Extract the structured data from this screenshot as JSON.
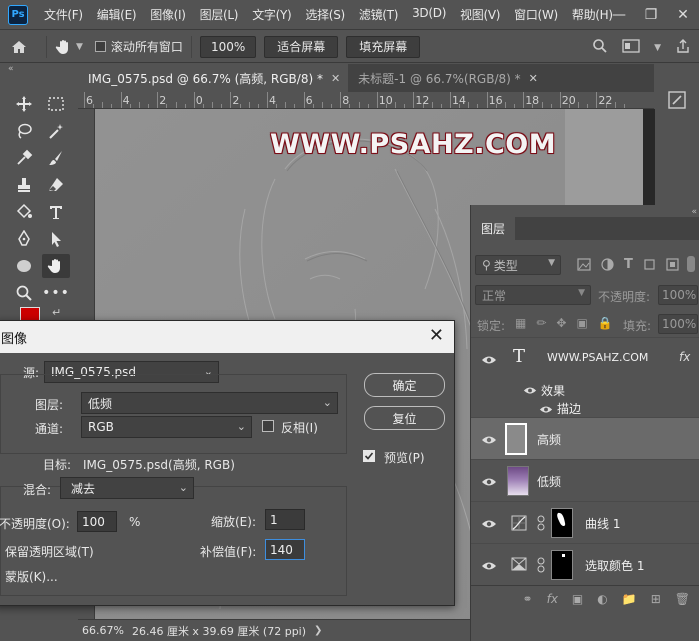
{
  "app": {
    "logo": "Ps"
  },
  "menu": [
    "文件(F)",
    "编辑(E)",
    "图像(I)",
    "图层(L)",
    "文字(Y)",
    "选择(S)",
    "滤镜(T)",
    "3D(D)",
    "视图(V)",
    "窗口(W)",
    "帮助(H)"
  ],
  "options_bar": {
    "scroll_all_label": "滚动所有窗口",
    "zoom_value": "100%",
    "fit_screen_label": "适合屏幕",
    "fill_screen_label": "填充屏幕"
  },
  "tabs": [
    {
      "label": "IMG_0575.psd @ 66.7% (高频, RGB/8) *",
      "active": true
    },
    {
      "label": "未标题-1 @ 66.7%(RGB/8) *",
      "active": false
    }
  ],
  "ruler_ticks": [
    "6",
    "4",
    "2",
    "0",
    "2",
    "4",
    "6",
    "8",
    "10",
    "12",
    "14",
    "16",
    "18",
    "20",
    "22"
  ],
  "canvas": {
    "watermark": "WWW.PSAHZ.COM"
  },
  "status": {
    "zoom": "66.67%",
    "doc_info": "26.46 厘米 x 39.69 厘米 (72 ppi)"
  },
  "layers_panel": {
    "title": "图层",
    "filter_placeholder": "类型",
    "blend_mode": "正常",
    "opacity_label": "不透明度:",
    "opacity_value": "100%",
    "lock_label": "锁定:",
    "fill_label": "填充:",
    "fill_value": "100%",
    "layers": [
      {
        "name": "WWW.PSAHZ.COM",
        "kind": "text",
        "fx": "fx",
        "effects_label": "效果",
        "effect_items": [
          "描边"
        ]
      },
      {
        "name": "高频",
        "kind": "pixel",
        "selected": true
      },
      {
        "name": "低频",
        "kind": "photo"
      },
      {
        "name": "曲线 1",
        "kind": "curves"
      },
      {
        "name": "选取颜色 1",
        "kind": "selective-color"
      }
    ]
  },
  "dialog": {
    "title": "图像",
    "source_label": "源:",
    "source_value": "IMG_0575.psd",
    "layer_label": "图层:",
    "layer_value": "低频",
    "channel_label": "通道:",
    "channel_value": "RGB",
    "invert_label": "反相(I)",
    "target_label": "目标:",
    "target_value": "IMG_0575.psd(高频, RGB)",
    "blending_label": "混合:",
    "blending_value": "减去",
    "opacity_label": "不透明度(O):",
    "opacity_value": "100",
    "opacity_unit": "%",
    "scale_label": "缩放(E):",
    "scale_value": "1",
    "offset_label": "补偿值(F):",
    "offset_value": "140",
    "preserve_label": "保留透明区域(T)",
    "mask_label": "蒙版(K)...",
    "ok_label": "确定",
    "reset_label": "复位",
    "preview_label": "预览(P)",
    "preview_checked": true
  },
  "colors": {
    "foreground": "#cc0000",
    "background": "#ffffff",
    "accent_outline": "#7a0c16"
  }
}
